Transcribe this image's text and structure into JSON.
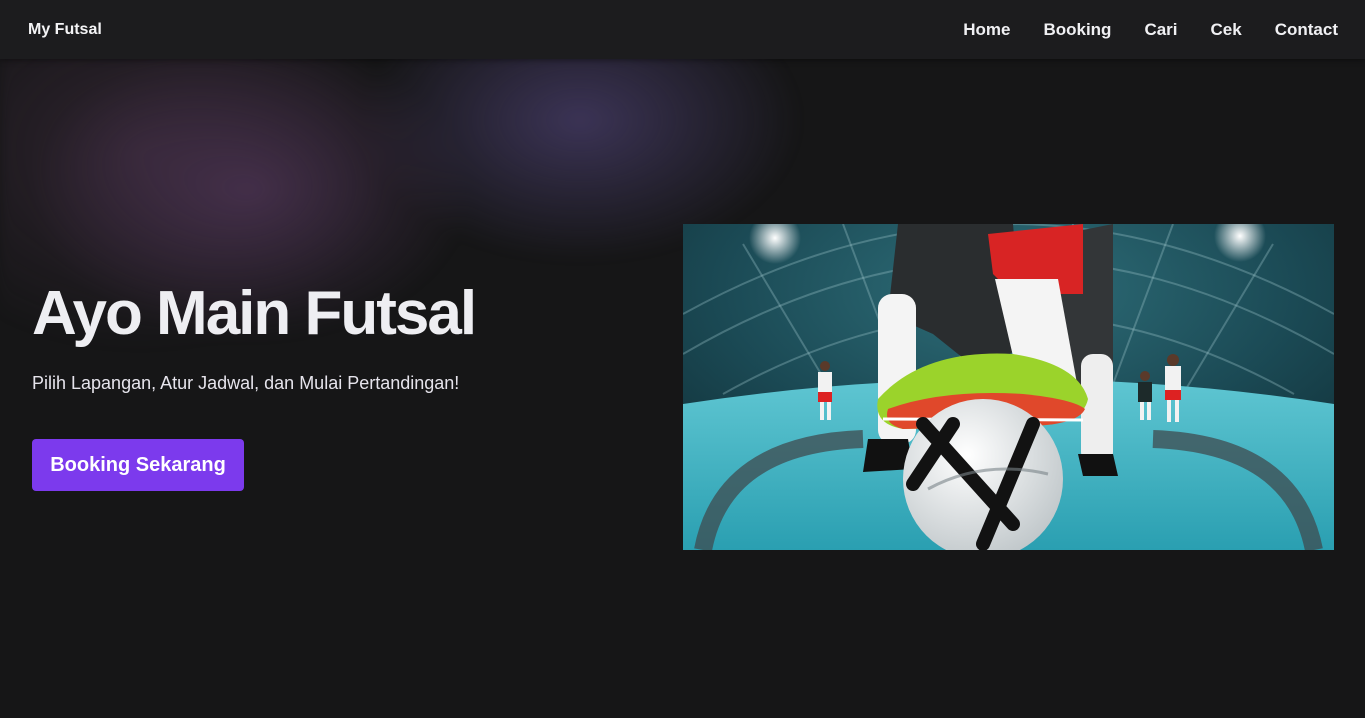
{
  "navbar": {
    "brand": "My Futsal",
    "links": [
      {
        "label": "Home"
      },
      {
        "label": "Booking"
      },
      {
        "label": "Cari"
      },
      {
        "label": "Cek"
      },
      {
        "label": "Contact"
      }
    ]
  },
  "hero": {
    "title": "Ayo Main Futsal",
    "subtitle": "Pilih Lapangan, Atur Jadwal, dan Mulai Pertandingan!",
    "cta_label": "Booking Sekarang",
    "image_icon": "futsal-action-photo"
  },
  "colors": {
    "background": "#161617",
    "navbar": "#1c1c1e",
    "accent": "#7c3aed"
  }
}
